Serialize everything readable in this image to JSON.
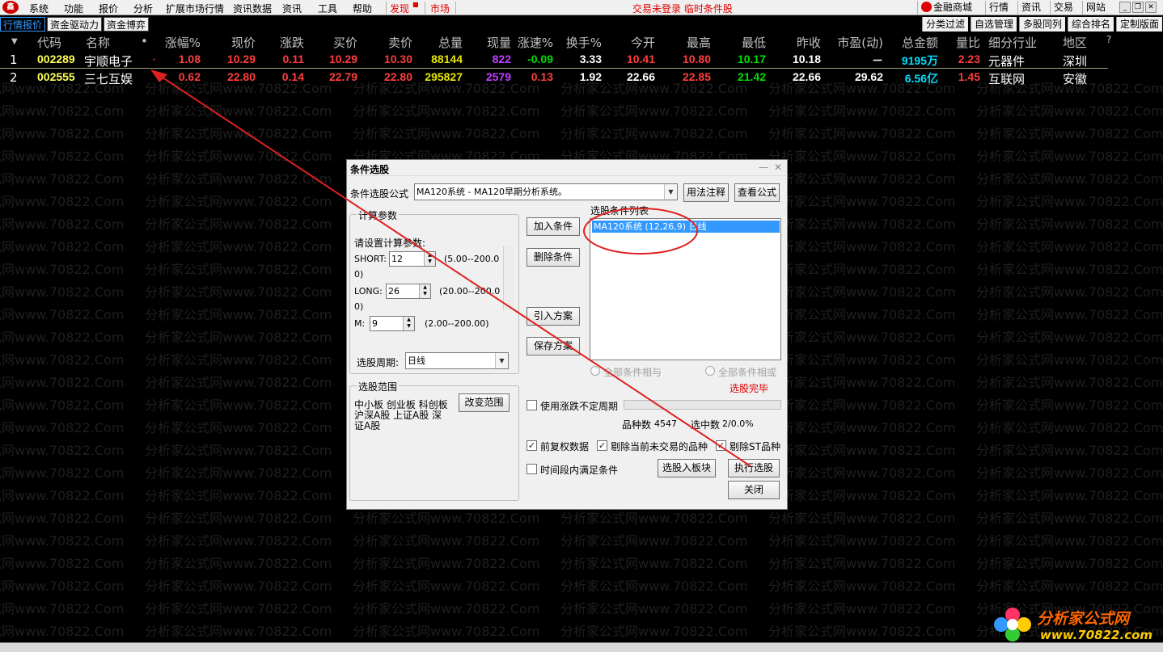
{
  "watermark_text": "分析家公式网www.70822.Com",
  "menubar": {
    "logo": "鑫",
    "items": [
      "系统",
      "功能",
      "报价",
      "分析",
      "扩展市场行情",
      "资讯数据",
      "资讯",
      "工具",
      "帮助"
    ],
    "discover": "发现",
    "market": "市场",
    "status": "交易未登录  临时条件股",
    "right": [
      "金融商城",
      "行情",
      "资讯",
      "交易",
      "网站"
    ]
  },
  "tabs": {
    "left": [
      "行情报价",
      "资金驱动力",
      "资金博弈"
    ],
    "right": [
      "分类过滤",
      "自选管理",
      "多股同列",
      "综合排名",
      "定制版面"
    ]
  },
  "quote": {
    "columns": [
      "代码",
      "名称",
      "•",
      "涨幅%",
      "现价",
      "涨跌",
      "买价",
      "卖价",
      "总量",
      "现量",
      "涨速%",
      "换手%",
      "今开",
      "最高",
      "最低",
      "昨收",
      "市盈(动)",
      "总金额",
      "量比",
      "细分行业",
      "地区",
      "?"
    ],
    "rows": [
      {
        "idx": "1",
        "code": "002289",
        "name": "宇顺电子",
        "dot": "·",
        "change_pct": "1.08",
        "price": "10.29",
        "change": "0.11",
        "bid": "10.29",
        "ask": "10.30",
        "volume": "88144",
        "cur_vol": "822",
        "speed": "-0.09",
        "turnover": "3.33",
        "open": "10.41",
        "high": "10.80",
        "low": "10.17",
        "prev_close": "10.18",
        "pe": "－",
        "amount": "9195万",
        "vol_ratio": "2.23",
        "industry": "元器件",
        "region": "深圳"
      },
      {
        "idx": "2",
        "code": "002555",
        "name": "三七互娱",
        "dot": "",
        "change_pct": "0.62",
        "price": "22.80",
        "change": "0.14",
        "bid": "22.79",
        "ask": "22.80",
        "volume": "295827",
        "cur_vol": "2579",
        "speed": "0.13",
        "turnover": "1.92",
        "open": "22.66",
        "high": "22.85",
        "low": "21.42",
        "prev_close": "22.66",
        "pe": "29.62",
        "amount": "6.56亿",
        "vol_ratio": "1.45",
        "industry": "互联网",
        "region": "安徽"
      }
    ]
  },
  "dialog": {
    "title": "条件选股",
    "formula_label": "条件选股公式",
    "formula_value": "MA120系统      - MA120早期分析系统。",
    "usage_btn": "用法注释",
    "view_btn": "查看公式",
    "params_group": "计算参数",
    "params_hint": "请设置计算参数:",
    "short_label": "SHORT:",
    "short_value": "12",
    "short_range": "(5.00--200.0",
    "short_range2": "0)",
    "long_label": "LONG:",
    "long_value": "26",
    "long_range": "(20.00--200.0",
    "long_range2": "0)",
    "m_label": "M:",
    "m_value": "9",
    "m_range": "(2.00--200.00)",
    "period_label": "选股周期:",
    "period_value": "日线",
    "add_btn": "加入条件",
    "del_btn": "删除条件",
    "import_btn": "引入方案",
    "save_btn": "保存方案",
    "list_label": "选股条件列表",
    "list_item": "MA120系统 (12,26,9) 日线",
    "radio_and": "全部条件相与",
    "radio_or": "全部条件相或",
    "done_text": "选股完毕",
    "range_group": "选股范围",
    "range_text_1": "中小板 创业板 科创板",
    "range_text_2": "沪深A股 上证A股 深",
    "range_text_3": "证A股",
    "change_range_btn": "改变范围",
    "uncertain_period": "使用涨跌不定周期",
    "count_label": "品种数",
    "count_value": "4547",
    "selected_label": "选中数",
    "selected_value": "2/0.0%",
    "chk_rights": "前复权数据",
    "chk_exclude_notrade": "剔除当前未交易的品种",
    "chk_exclude_st": "剔除ST品种",
    "chk_period_meet": "时间段内满足条件",
    "to_block_btn": "选股入板块",
    "exec_btn": "执行选股",
    "close_btn": "关闭"
  },
  "logo": {
    "name": "分析家公式网",
    "url": "www.70822.com"
  },
  "colors": {
    "up": "#ff3c3c",
    "down": "#00e000",
    "neutral": "#ffffff",
    "code": "#ffff54",
    "volume": "#e6e600",
    "cur_vol": "#c040ff",
    "amount": "#00e0ff",
    "annotation": "#e02020"
  }
}
